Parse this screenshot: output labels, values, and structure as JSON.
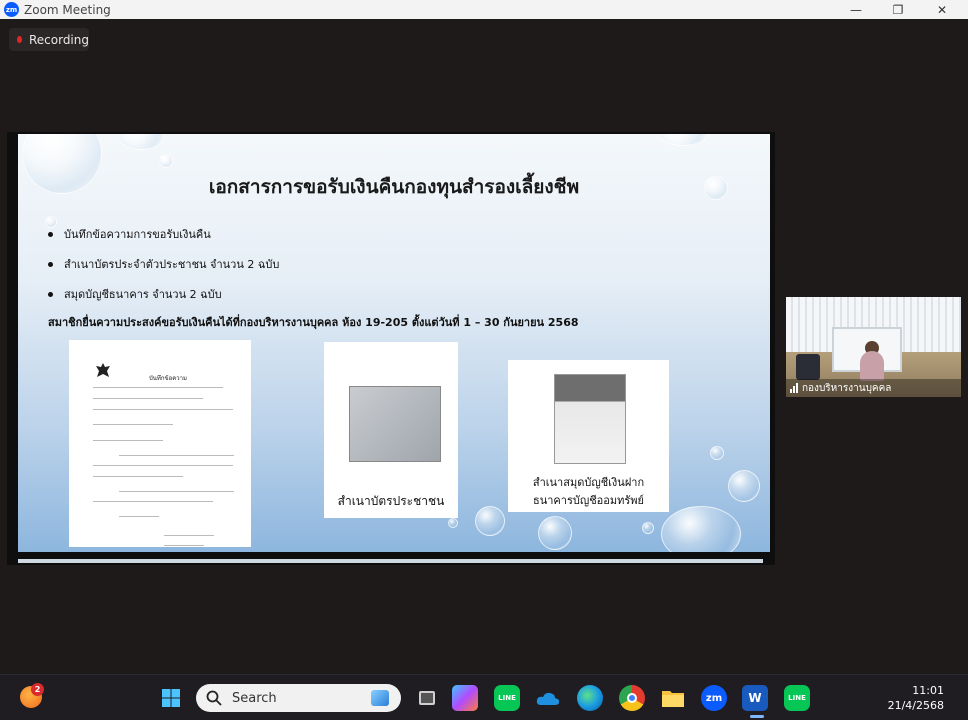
{
  "window": {
    "app_icon_text": "zm",
    "title": "Zoom Meeting",
    "minimize_glyph": "—",
    "maximize_glyph": "❐",
    "close_glyph": "✕"
  },
  "recording": {
    "label": "Recording"
  },
  "slide": {
    "title": "เอกสารการขอรับเงินคืนกองทุนสำรองเลี้ยงชีพ",
    "bullets": [
      "บันทึกข้อความการขอรับเงินคืน",
      "สำเนาบัตรประจำตัวประชาชน จำนวน 2 ฉบับ",
      "สมุดบัญชีธนาคาร จำนวน 2 ฉบับ"
    ],
    "note": "สมาชิกยื่นความประสงค์ขอรับเงินคืนได้ที่กองบริหารงานบุคคล ห้อง 19-205 ตั้งแต่วันที่ 1 – 30 กันยายน 2568",
    "memo_heading": "บันทึกข้อความ",
    "idcard_caption": "สำเนาบัตรประชาชน",
    "bankbook_caption_line1": "สำเนาสมุดบัญชีเงินฝาก",
    "bankbook_caption_line2": "ธนาคารบัญชีออมทรัพย์"
  },
  "participant": {
    "name": "กองบริหารงานบุคคล"
  },
  "taskbar": {
    "search_label": "Search",
    "notification_count": "2",
    "time": "11:01",
    "date": "21/4/2568",
    "apps": [
      "task-view",
      "copilot",
      "line",
      "onedrive",
      "edge",
      "chrome",
      "file-explorer",
      "zoom",
      "word",
      "line"
    ]
  },
  "colors": {
    "zoom_blue": "#0b5cff",
    "recording_red": "#e02828",
    "line_green": "#06c755",
    "word_blue": "#185abd"
  }
}
